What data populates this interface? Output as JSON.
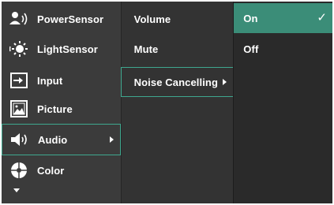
{
  "menu": {
    "items": [
      {
        "label": "PowerSensor",
        "icon": "power-sensor-icon"
      },
      {
        "label": "LightSensor",
        "icon": "light-sensor-icon"
      },
      {
        "label": "Input",
        "icon": "input-icon"
      },
      {
        "label": "Picture",
        "icon": "picture-icon"
      },
      {
        "label": "Audio",
        "icon": "speaker-icon",
        "selected": true
      },
      {
        "label": "Color",
        "icon": "color-icon"
      }
    ]
  },
  "submenu": {
    "items": [
      {
        "label": "Volume"
      },
      {
        "label": "Mute"
      },
      {
        "label": "Noise Cancelling",
        "selected": true
      }
    ]
  },
  "options": {
    "items": [
      {
        "label": "On",
        "active": true
      },
      {
        "label": "Off"
      }
    ]
  },
  "colors": {
    "background": "#3b3b3b",
    "highlight_border": "#3ea88f",
    "active_option": "#3b8d78"
  }
}
